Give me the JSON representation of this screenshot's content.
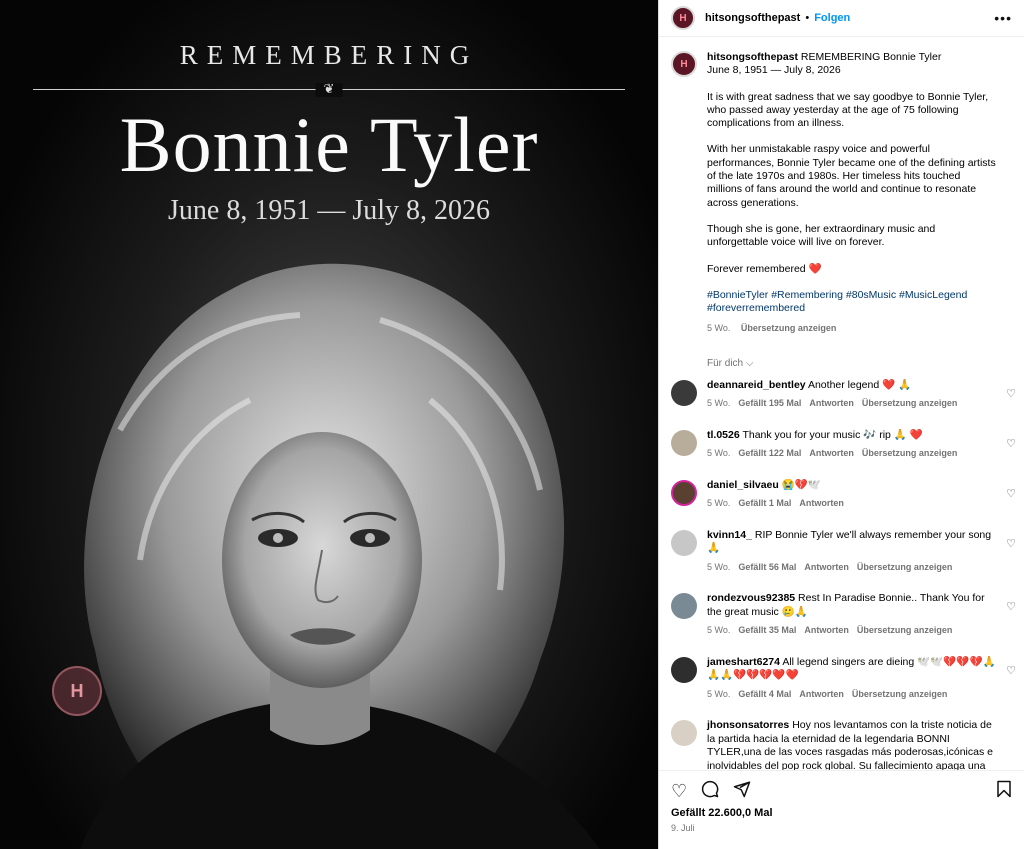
{
  "poster": {
    "remembering": "REMEMBERING",
    "name": "Bonnie Tyler",
    "dates": "June 8, 1951 — July 8, 2026",
    "watermark": "H"
  },
  "header": {
    "username": "hitsongsofthepast",
    "follow": "Folgen",
    "more_icon": "more-icon"
  },
  "caption": {
    "username": "hitsongsofthepast",
    "line1": "REMEMBERING Bonnie Tyler",
    "line2": "June 8, 1951 — July 8, 2026",
    "p1": "It is with great sadness that we say goodbye to Bonnie Tyler, who passed away yesterday at the age of 75 following complications from an illness.",
    "p2": "With her unmistakable raspy voice and powerful performances, Bonnie Tyler became one of the defining artists of the late 1970s and 1980s. Her timeless hits touched millions of fans around the world and continue to resonate across generations.",
    "p3": "Though she is gone, her extraordinary music and unforgettable voice will live on forever.",
    "p4": "Forever remembered ❤️",
    "hashtags": "#BonnieTyler #Remembering #80sMusic #MusicLegend #foreverremembered",
    "time": "5 Wo.",
    "translate": "Übersetzung anzeigen"
  },
  "for_you": "Für dich",
  "comments": [
    {
      "user": "deannareid_bentley",
      "text": "Another legend ❤️ 🙏",
      "time": "5 Wo.",
      "likes": "Gefällt 195 Mal",
      "reply": "Antworten",
      "translate": "Übersetzung anzeigen",
      "avatar_color": "#3a3a3a"
    },
    {
      "user": "tl.0526",
      "text": "Thank you for your music 🎶 rip 🙏 ❤️",
      "time": "5 Wo.",
      "likes": "Gefällt 122 Mal",
      "reply": "Antworten",
      "translate": "Übersetzung anzeigen",
      "avatar_color": "#b8ad9a"
    },
    {
      "user": "daniel_silvaeu",
      "text": "😭💔🕊️",
      "time": "5 Wo.",
      "likes": "Gefällt 1 Mal",
      "reply": "Antworten",
      "translate": "",
      "avatar_color": "#5a4030"
    },
    {
      "user": "kvinn14_",
      "text": "RIP Bonnie Tyler we'll always remember your song 🙏",
      "time": "5 Wo.",
      "likes": "Gefällt 56 Mal",
      "reply": "Antworten",
      "translate": "Übersetzung anzeigen",
      "avatar_color": "#c7c7c7"
    },
    {
      "user": "rondezvous92385",
      "text": "Rest In Paradise Bonnie.. Thank You for the great music 🥲🙏",
      "time": "5 Wo.",
      "likes": "Gefällt 35 Mal",
      "reply": "Antworten",
      "translate": "Übersetzung anzeigen",
      "avatar_color": "#7a8a94"
    },
    {
      "user": "jameshart6274",
      "text": "All legend singers are dieing 🕊️🕊️💔💔💔🙏🙏🙏💔💔💔❤️❤️",
      "time": "5 Wo.",
      "likes": "Gefällt 4 Mal",
      "reply": "Antworten",
      "translate": "Übersetzung anzeigen",
      "avatar_color": "#2e2e2e"
    },
    {
      "user": "jhonsonsatorres",
      "text": "Hoy nos levantamos con la triste noticia de la partida hacia la eternidad de la legendaria BONNI TYLER,una de las voces rasgadas más poderosas,icónicas e inolvidables del pop rock global. Su fallecimiento apaga una luz en los escenarios pero enciende una luz inmortal en el",
      "time": "",
      "likes": "",
      "reply": "",
      "translate": "",
      "avatar_color": "#d8d0c4"
    }
  ],
  "footer": {
    "likes": "Gefällt 22.600,0 Mal",
    "date": "9. Juli",
    "icons": [
      "heart-icon",
      "comment-icon",
      "share-icon",
      "bookmark-icon"
    ]
  }
}
